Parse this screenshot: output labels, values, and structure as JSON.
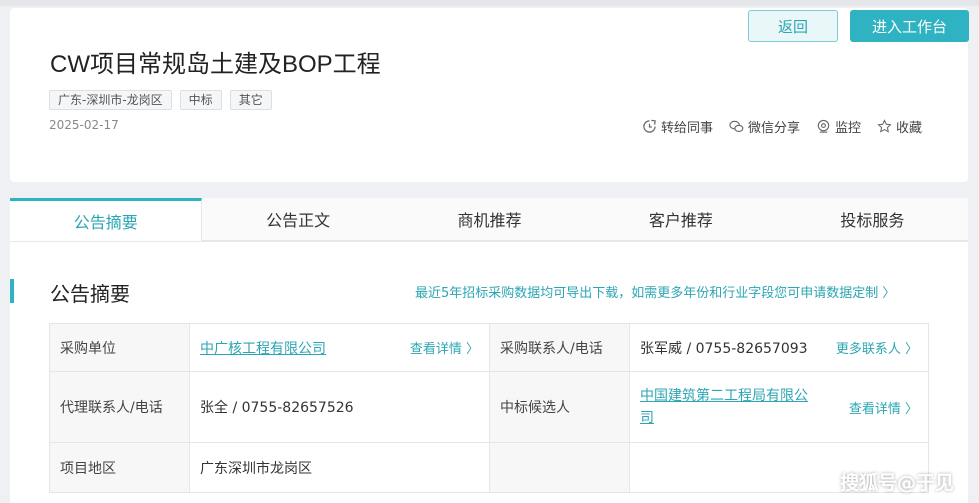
{
  "header": {
    "back_label": "返回",
    "workbench_label": "进入工作台",
    "title": "CW项目常规岛土建及BOP工程",
    "tags": [
      "广东-深圳市-龙岗区",
      "中标",
      "其它"
    ],
    "date": "2025-02-17",
    "actions": [
      {
        "label": "转给同事",
        "icon": "share-colleague-icon"
      },
      {
        "label": "微信分享",
        "icon": "wechat-icon"
      },
      {
        "label": "监控",
        "icon": "monitor-icon"
      },
      {
        "label": "收藏",
        "icon": "star-icon"
      }
    ]
  },
  "tabs": [
    {
      "label": "公告摘要",
      "active": true
    },
    {
      "label": "公告正文",
      "active": false
    },
    {
      "label": "商机推荐",
      "active": false
    },
    {
      "label": "客户推荐",
      "active": false
    },
    {
      "label": "投标服务",
      "active": false
    }
  ],
  "summary": {
    "section_title": "公告摘要",
    "export_link": "最近5年招标采购数据均可导出下载，如需更多年份和行业字段您可申请数据定制 〉",
    "rows": [
      {
        "label1": "采购单位",
        "value1": "中广核工程有限公司",
        "link1": "查看详情 〉",
        "label2": "采购联系人/电话",
        "value2": "张军威 / 0755-82657093",
        "link2": "更多联系人 〉"
      },
      {
        "label1": "代理联系人/电话",
        "value1": "张全 / 0755-82657526",
        "label2": "中标候选人",
        "value2": "中国建筑第二工程局有限公司",
        "link2": "查看详情 〉"
      },
      {
        "label1": "项目地区",
        "value1": "广东深圳市龙岗区"
      }
    ]
  },
  "watermark": "搜狐号@于见",
  "colors": {
    "accent": "#2fb3c2",
    "link": "#2ba6b3"
  }
}
